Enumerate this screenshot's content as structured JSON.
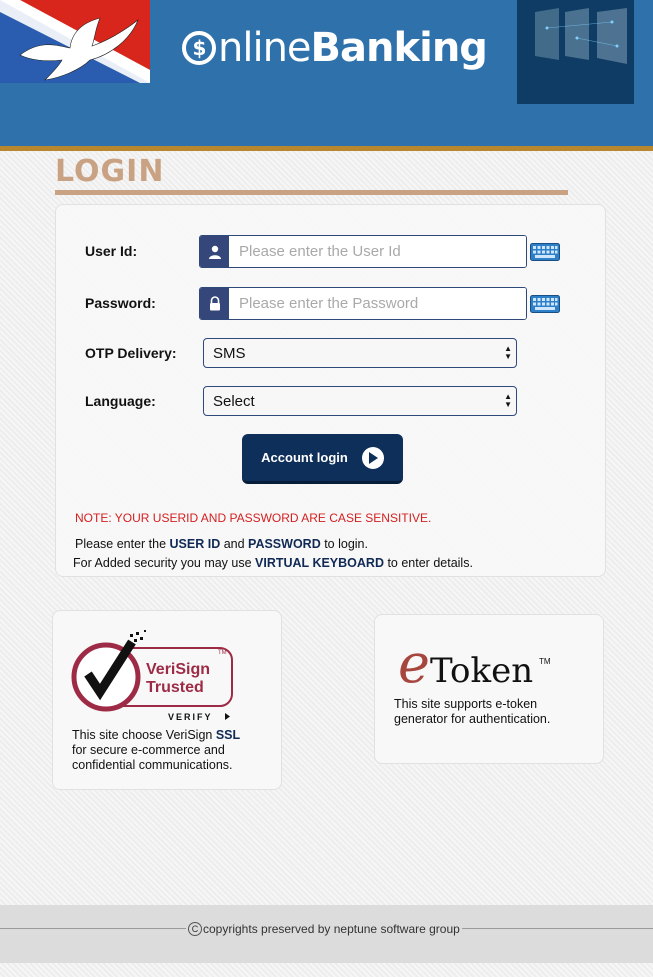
{
  "header": {
    "brand_prefix": "nline",
    "brand_coin": "$",
    "brand_bold": "Banking"
  },
  "login": {
    "title": "LOGIN",
    "user_id_label": "User Id:",
    "user_id_placeholder": "Please enter the User Id",
    "password_label": "Password:",
    "password_placeholder": "Please enter the Password",
    "otp_label": "OTP Delivery:",
    "otp_selected": "SMS",
    "language_label": "Language:",
    "language_selected": "Select",
    "button_label": "Account login",
    "note": "NOTE: YOUR USERID AND PASSWORD ARE CASE SENSITIVE.",
    "info1_a": "Please enter the ",
    "info1_b": "USER ID",
    "info1_c": " and ",
    "info1_d": "PASSWORD",
    "info1_e": " to login.",
    "info2_a": "For Added security you may use ",
    "info2_b": "VIRTUAL KEYBOARD",
    "info2_c": " to enter details."
  },
  "verisign": {
    "logo_line1": "VeriSign",
    "logo_line2": "Trusted",
    "logo_verify": "VERIFY",
    "tm": "TM",
    "text_a": "This site choose VeriSign ",
    "text_b": "SSL",
    "text_c": "for secure e-commerce and",
    "text_d": "confidential communications."
  },
  "etoken": {
    "logo_e": "e",
    "logo_rest": "Token",
    "tm": "TM",
    "text_a": "This site supports e-token",
    "text_b": "generator for authentication."
  },
  "footer": {
    "copy_symbol": "C",
    "text": "copyrights preserved by neptune software group"
  },
  "colors": {
    "header_bg": "#2f71ab",
    "accent_gold": "#b8862c",
    "login_title": "#c9a283",
    "button_bg": "#0f2f5b",
    "note_red": "#d42020"
  }
}
